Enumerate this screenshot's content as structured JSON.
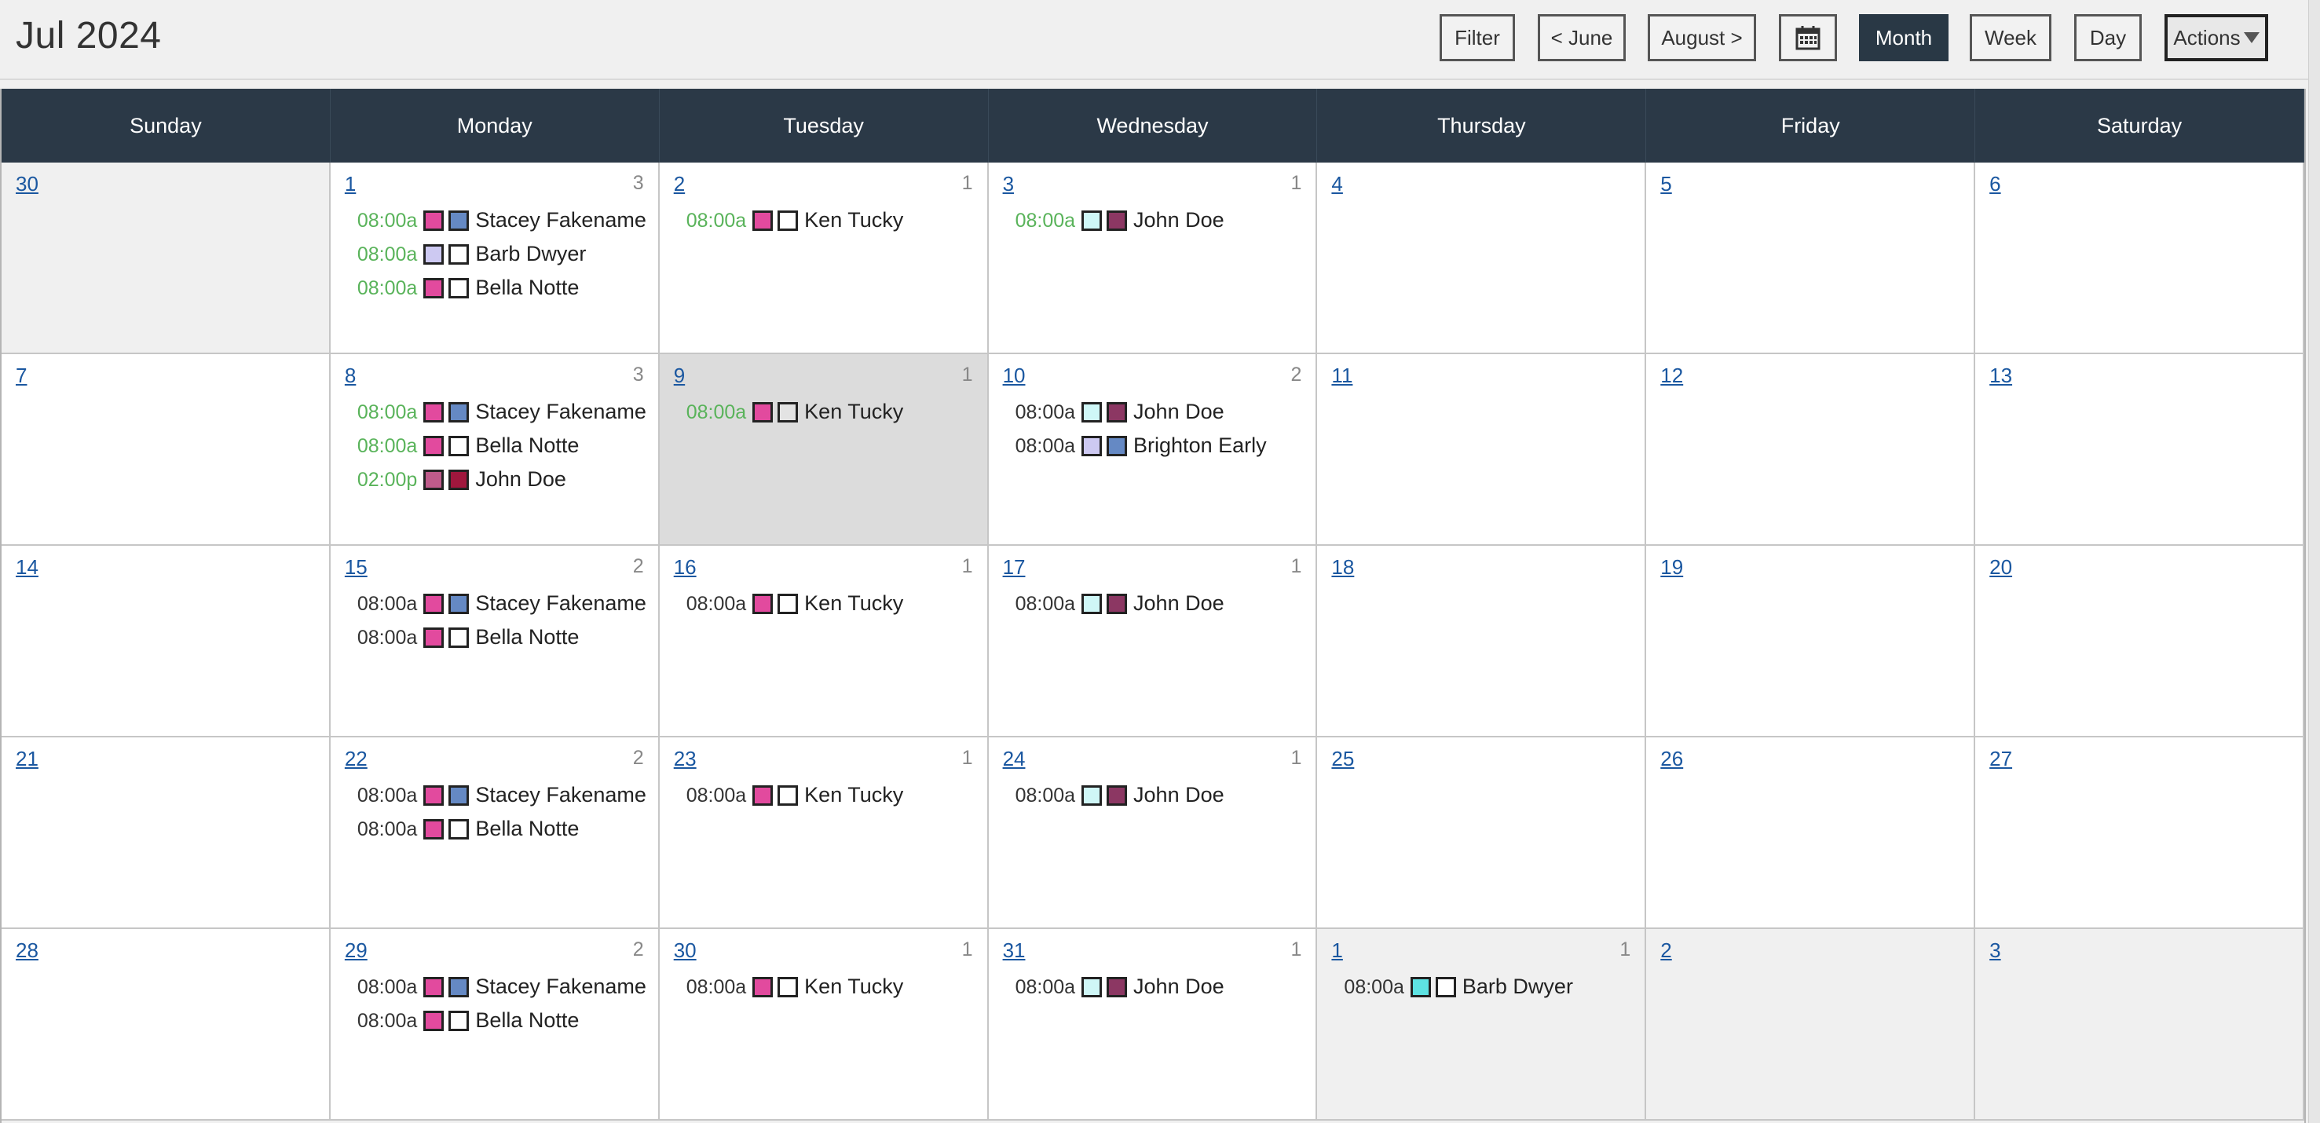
{
  "header": {
    "title": "Jul 2024",
    "filter_label": "Filter",
    "prev_label": "< June",
    "next_label": "August >",
    "calendar_icon": "calendar-icon",
    "month_label": "Month",
    "week_label": "Week",
    "day_label": "Day",
    "actions_label": "Actions"
  },
  "weekdays": [
    "Sunday",
    "Monday",
    "Tuesday",
    "Wednesday",
    "Thursday",
    "Friday",
    "Saturday"
  ],
  "colors": {
    "header_bg": "#2b3947",
    "link": "#1a57a0",
    "time_green": "#59b35a",
    "pink": "#e24a9e",
    "blue": "#6589c4",
    "lavender": "#cdc9f2",
    "cyan": "#cff7f7",
    "aqua": "#5ee3e3",
    "plum": "#8c3763",
    "mauve": "#bf5b8b",
    "crimson": "#a0173d",
    "white": "#ffffff",
    "gray": "#e3e3e3"
  },
  "weeks": [
    [
      {
        "day": "30",
        "count": "",
        "type": "other",
        "events": []
      },
      {
        "day": "1",
        "count": "3",
        "type": "",
        "events": [
          {
            "time": "08:00a",
            "green": true,
            "c1": "#e24a9e",
            "c2": "#6589c4",
            "name": "Stacey Fakename"
          },
          {
            "time": "08:00a",
            "green": true,
            "c1": "#cdc9f2",
            "c2": "#ffffff",
            "name": "Barb Dwyer"
          },
          {
            "time": "08:00a",
            "green": true,
            "c1": "#e24a9e",
            "c2": "#ffffff",
            "name": "Bella Notte"
          }
        ]
      },
      {
        "day": "2",
        "count": "1",
        "type": "",
        "events": [
          {
            "time": "08:00a",
            "green": true,
            "c1": "#e24a9e",
            "c2": "#ffffff",
            "name": "Ken Tucky"
          }
        ]
      },
      {
        "day": "3",
        "count": "1",
        "type": "",
        "events": [
          {
            "time": "08:00a",
            "green": true,
            "c1": "#cff7f7",
            "c2": "#8c3763",
            "name": "John Doe"
          }
        ]
      },
      {
        "day": "4",
        "count": "",
        "type": "",
        "events": []
      },
      {
        "day": "5",
        "count": "",
        "type": "",
        "events": []
      },
      {
        "day": "6",
        "count": "",
        "type": "",
        "events": []
      }
    ],
    [
      {
        "day": "7",
        "count": "",
        "type": "",
        "events": []
      },
      {
        "day": "8",
        "count": "3",
        "type": "",
        "events": [
          {
            "time": "08:00a",
            "green": true,
            "c1": "#e24a9e",
            "c2": "#6589c4",
            "name": "Stacey Fakename"
          },
          {
            "time": "08:00a",
            "green": true,
            "c1": "#e24a9e",
            "c2": "#ffffff",
            "name": "Bella Notte"
          },
          {
            "time": "02:00p",
            "green": true,
            "c1": "#bf5b8b",
            "c2": "#a0173d",
            "name": "John Doe"
          }
        ]
      },
      {
        "day": "9",
        "count": "1",
        "type": "today",
        "events": [
          {
            "time": "08:00a",
            "green": true,
            "c1": "#e24a9e",
            "c2": "#e3e3e3",
            "name": "Ken Tucky"
          }
        ]
      },
      {
        "day": "10",
        "count": "2",
        "type": "",
        "events": [
          {
            "time": "08:00a",
            "green": false,
            "c1": "#cff7f7",
            "c2": "#8c3763",
            "name": "John Doe"
          },
          {
            "time": "08:00a",
            "green": false,
            "c1": "#cdc9f2",
            "c2": "#6589c4",
            "name": "Brighton Early"
          }
        ]
      },
      {
        "day": "11",
        "count": "",
        "type": "",
        "events": []
      },
      {
        "day": "12",
        "count": "",
        "type": "",
        "events": []
      },
      {
        "day": "13",
        "count": "",
        "type": "",
        "events": []
      }
    ],
    [
      {
        "day": "14",
        "count": "",
        "type": "",
        "events": []
      },
      {
        "day": "15",
        "count": "2",
        "type": "",
        "events": [
          {
            "time": "08:00a",
            "green": false,
            "c1": "#e24a9e",
            "c2": "#6589c4",
            "name": "Stacey Fakename"
          },
          {
            "time": "08:00a",
            "green": false,
            "c1": "#e24a9e",
            "c2": "#ffffff",
            "name": "Bella Notte"
          }
        ]
      },
      {
        "day": "16",
        "count": "1",
        "type": "",
        "events": [
          {
            "time": "08:00a",
            "green": false,
            "c1": "#e24a9e",
            "c2": "#ffffff",
            "name": "Ken Tucky"
          }
        ]
      },
      {
        "day": "17",
        "count": "1",
        "type": "",
        "events": [
          {
            "time": "08:00a",
            "green": false,
            "c1": "#cff7f7",
            "c2": "#8c3763",
            "name": "John Doe"
          }
        ]
      },
      {
        "day": "18",
        "count": "",
        "type": "",
        "events": []
      },
      {
        "day": "19",
        "count": "",
        "type": "",
        "events": []
      },
      {
        "day": "20",
        "count": "",
        "type": "",
        "events": []
      }
    ],
    [
      {
        "day": "21",
        "count": "",
        "type": "",
        "events": []
      },
      {
        "day": "22",
        "count": "2",
        "type": "",
        "events": [
          {
            "time": "08:00a",
            "green": false,
            "c1": "#e24a9e",
            "c2": "#6589c4",
            "name": "Stacey Fakename"
          },
          {
            "time": "08:00a",
            "green": false,
            "c1": "#e24a9e",
            "c2": "#ffffff",
            "name": "Bella Notte"
          }
        ]
      },
      {
        "day": "23",
        "count": "1",
        "type": "",
        "events": [
          {
            "time": "08:00a",
            "green": false,
            "c1": "#e24a9e",
            "c2": "#ffffff",
            "name": "Ken Tucky"
          }
        ]
      },
      {
        "day": "24",
        "count": "1",
        "type": "",
        "events": [
          {
            "time": "08:00a",
            "green": false,
            "c1": "#cff7f7",
            "c2": "#8c3763",
            "name": "John Doe"
          }
        ]
      },
      {
        "day": "25",
        "count": "",
        "type": "",
        "events": []
      },
      {
        "day": "26",
        "count": "",
        "type": "",
        "events": []
      },
      {
        "day": "27",
        "count": "",
        "type": "",
        "events": []
      }
    ],
    [
      {
        "day": "28",
        "count": "",
        "type": "",
        "events": []
      },
      {
        "day": "29",
        "count": "2",
        "type": "",
        "events": [
          {
            "time": "08:00a",
            "green": false,
            "c1": "#e24a9e",
            "c2": "#6589c4",
            "name": "Stacey Fakename"
          },
          {
            "time": "08:00a",
            "green": false,
            "c1": "#e24a9e",
            "c2": "#ffffff",
            "name": "Bella Notte"
          }
        ]
      },
      {
        "day": "30",
        "count": "1",
        "type": "",
        "events": [
          {
            "time": "08:00a",
            "green": false,
            "c1": "#e24a9e",
            "c2": "#ffffff",
            "name": "Ken Tucky"
          }
        ]
      },
      {
        "day": "31",
        "count": "1",
        "type": "",
        "events": [
          {
            "time": "08:00a",
            "green": false,
            "c1": "#cff7f7",
            "c2": "#8c3763",
            "name": "John Doe"
          }
        ]
      },
      {
        "day": "1",
        "count": "1",
        "type": "other",
        "events": [
          {
            "time": "08:00a",
            "green": false,
            "c1": "#5ee3e3",
            "c2": "#ffffff",
            "name": "Barb Dwyer"
          }
        ]
      },
      {
        "day": "2",
        "count": "",
        "type": "other",
        "events": []
      },
      {
        "day": "3",
        "count": "",
        "type": "other",
        "events": []
      }
    ]
  ]
}
